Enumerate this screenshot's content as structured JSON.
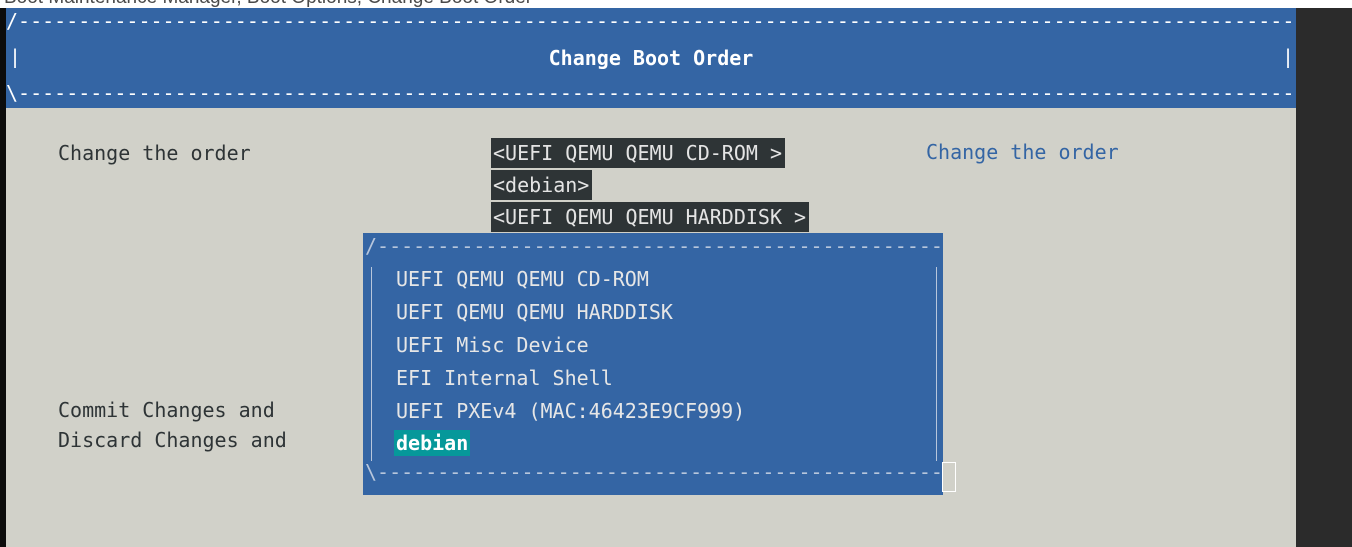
{
  "caption": "Boot Maintenance Manager, Boot Options, Change Boot Order",
  "header": {
    "title": "Change Boot Order"
  },
  "form": {
    "change_order_label": "Change the order",
    "commit_label": "Commit Changes and",
    "discard_label": "Discard Changes and",
    "order_items": [
      "<UEFI QEMU QEMU CD-ROM >",
      "<debian>",
      "<UEFI QEMU QEMU HARDDISK >"
    ]
  },
  "help": {
    "text": "Change the order"
  },
  "popup": {
    "items": [
      "UEFI QEMU QEMU CD-ROM",
      "UEFI QEMU QEMU HARDDISK",
      "UEFI Misc Device",
      "EFI Internal Shell",
      "UEFI PXEv4 (MAC:46423E9CF999)",
      "debian"
    ],
    "selected_index": 5
  },
  "colors": {
    "background": "#d1d1c9",
    "banner": "#3465a4",
    "selection": "#06989a",
    "field": "#2e3436"
  }
}
